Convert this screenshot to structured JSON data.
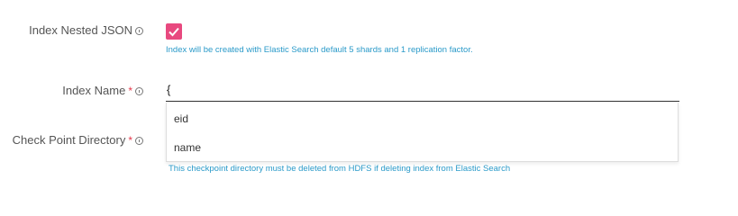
{
  "fields": {
    "index_nested_json": {
      "label": "Index Nested JSON",
      "checked": true,
      "help": "Index will be created with Elastic Search default 5 shards and 1 replication factor."
    },
    "index_name": {
      "label": "Index Name",
      "required_marker": "*",
      "value": "{",
      "suggestions": [
        "eid",
        "name"
      ]
    },
    "checkpoint_directory": {
      "label": "Check Point Directory",
      "required_marker": "*",
      "help": "This checkpoint directory must be deleted from HDFS if deleting index from Elastic Search"
    }
  },
  "colors": {
    "accent": "#e8497f",
    "help_text": "#2a9ac9",
    "required": "#e5384b"
  }
}
